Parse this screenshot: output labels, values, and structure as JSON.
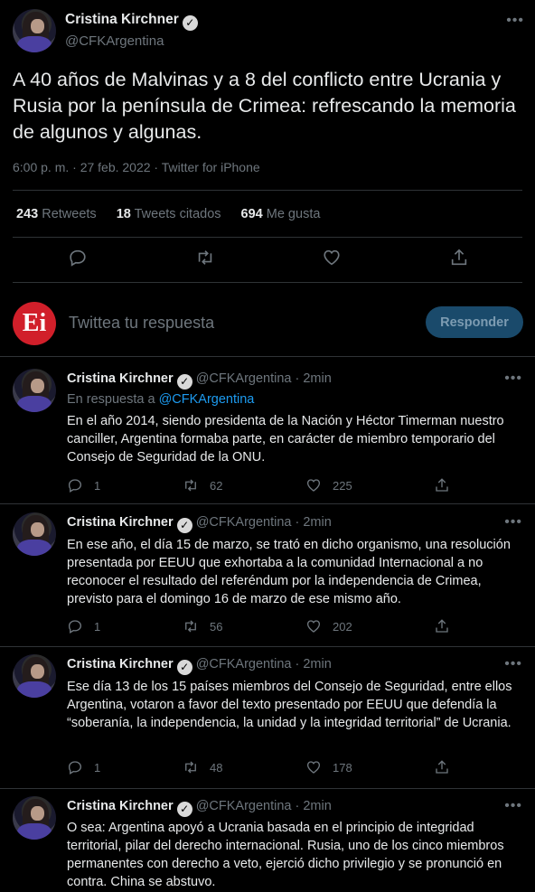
{
  "main_tweet": {
    "name": "Cristina Kirchner",
    "handle": "@CFKArgentina",
    "text": "A 40 años de Malvinas y a 8 del conflicto entre Ucrania y Rusia por la península de Crimea: refrescando la memoria de algunos y algunas.",
    "meta": "6:00 p. m. · 27 feb. 2022 · Twitter for iPhone",
    "stats": {
      "retweets_count": "243",
      "retweets_label": "Retweets",
      "quotes_count": "18",
      "quotes_label": "Tweets citados",
      "likes_count": "694",
      "likes_label": "Me gusta"
    }
  },
  "reply_box": {
    "logo_text": "Ei",
    "placeholder": "Twittea tu respuesta",
    "button_label": "Responder"
  },
  "replies": [
    {
      "name": "Cristina Kirchner",
      "handle": "@CFKArgentina",
      "time": "· 2min",
      "reply_to_prefix": "En respuesta a",
      "reply_to_handle": "@CFKArgentina",
      "text": "En el año 2014, siendo presidenta de la Nación y Héctor Timerman nuestro canciller, Argentina formaba parte, en carácter de miembro temporario del Consejo de Seguridad de la ONU.",
      "replies": "1",
      "retweets": "62",
      "likes": "225"
    },
    {
      "name": "Cristina Kirchner",
      "handle": "@CFKArgentina",
      "time": "· 2min",
      "text": "En ese año, el día 15 de marzo, se trató en dicho organismo, una resolución presentada por EEUU que exhortaba a la comunidad Internacional a no reconocer el resultado del referéndum por la independencia de Crimea, previsto para el domingo 16 de marzo de ese mismo año.",
      "replies": "1",
      "retweets": "56",
      "likes": "202"
    },
    {
      "name": "Cristina Kirchner",
      "handle": "@CFKArgentina",
      "time": "· 2min",
      "text": "Ese día 13 de los 15 países miembros del Consejo de Seguridad, entre ellos Argentina, votaron a favor del texto presentado por EEUU que defendía la “soberanía, la independencia, la unidad y la integridad territorial” de Ucrania.",
      "replies": "1",
      "retweets": "48",
      "likes": "178"
    },
    {
      "name": "Cristina Kirchner",
      "handle": "@CFKArgentina",
      "time": "· 2min",
      "text": "O sea: Argentina apoyó a Ucrania basada en el principio de integridad territorial, pilar del derecho internacional. Rusia, uno de los cinco miembros permanentes con derecho a veto, ejerció dicho privilegio y se pronunció en contra. China se abstuvo."
    }
  ],
  "icons": {
    "more": "more-icon",
    "reply": "reply-icon",
    "retweet": "retweet-icon",
    "like": "like-icon",
    "share": "share-icon",
    "verified": "verified-icon"
  },
  "colors": {
    "background": "#000000",
    "link": "#1d9bf0",
    "muted": "#6e767d",
    "brand_logo": "#d11f2a"
  }
}
